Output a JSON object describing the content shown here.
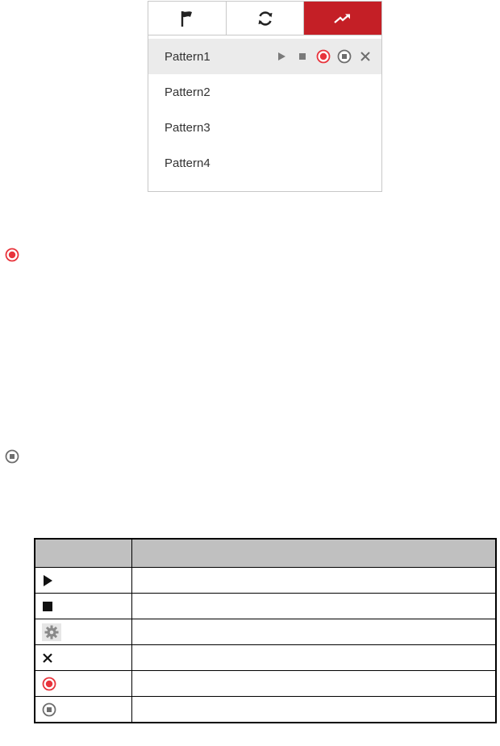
{
  "panel": {
    "tabs": [
      {
        "icon": "flag-icon",
        "active": false
      },
      {
        "icon": "refresh-icon",
        "active": false
      },
      {
        "icon": "trend-arrow-icon",
        "active": true
      }
    ],
    "patterns": [
      {
        "label": "Pattern1",
        "selected": true
      },
      {
        "label": "Pattern2",
        "selected": false
      },
      {
        "label": "Pattern3",
        "selected": false
      },
      {
        "label": "Pattern4",
        "selected": false
      }
    ],
    "row_actions": [
      "play-icon",
      "stop-icon",
      "record-start-icon",
      "record-stop-icon",
      "delete-icon"
    ]
  },
  "standalone_icons": [
    "record-start-icon",
    "record-stop-icon"
  ],
  "reference_table": {
    "headers": [
      "",
      ""
    ],
    "rows": [
      {
        "icon": "play-icon",
        "text": ""
      },
      {
        "icon": "stop-icon",
        "text": ""
      },
      {
        "icon": "gear-icon",
        "text": ""
      },
      {
        "icon": "delete-icon",
        "text": ""
      },
      {
        "icon": "record-start-icon",
        "text": ""
      },
      {
        "icon": "record-stop-icon",
        "text": ""
      }
    ]
  },
  "colors": {
    "accent": "#c41f26",
    "record_red": "#e8343c",
    "selected_row": "#ebebeb",
    "table_header": "#c0c0c0"
  }
}
